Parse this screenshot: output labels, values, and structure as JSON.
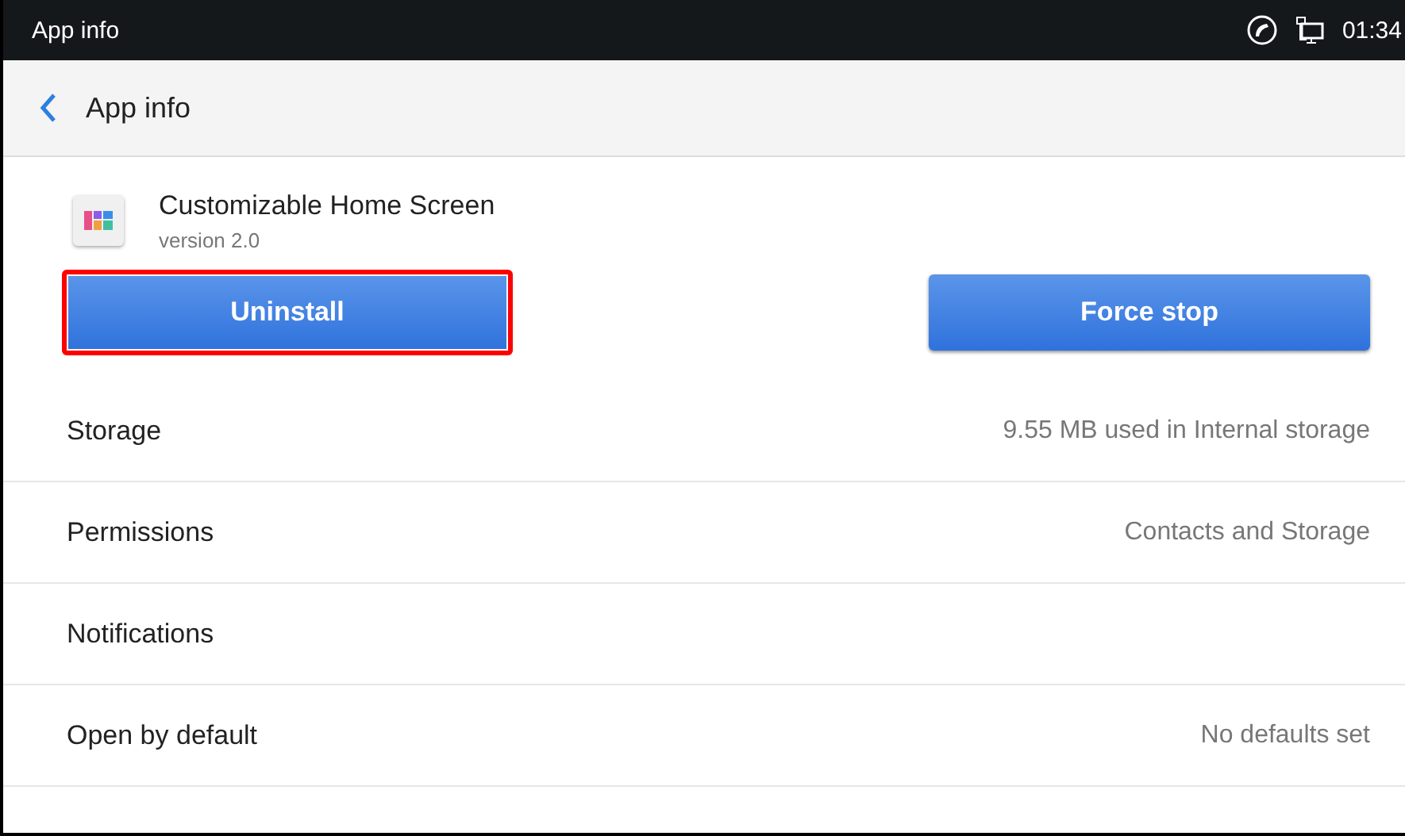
{
  "status_bar": {
    "title": "App info",
    "time": "01:34"
  },
  "header": {
    "title": "App info"
  },
  "app": {
    "name": "Customizable Home Screen",
    "version": "version 2.0"
  },
  "buttons": [
    {
      "label": "Uninstall",
      "highlighted": true
    },
    {
      "label": "Force stop",
      "highlighted": false
    }
  ],
  "rows": [
    {
      "label": "Storage",
      "value": "9.55 MB used in Internal storage"
    },
    {
      "label": "Permissions",
      "value": "Contacts and Storage"
    },
    {
      "label": "Notifications"
    },
    {
      "label": "Open by default",
      "value": "No defaults set"
    }
  ]
}
